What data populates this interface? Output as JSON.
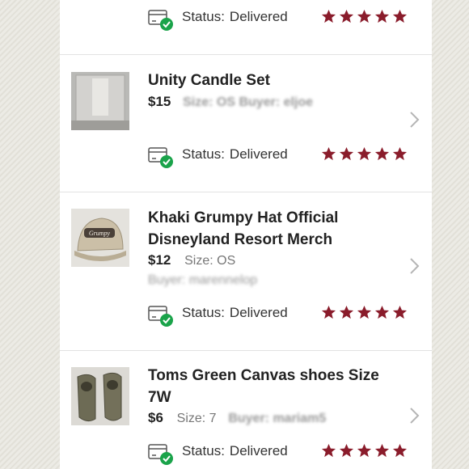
{
  "listings": [
    {
      "title_lines": [],
      "price": "",
      "status_label": "Status:",
      "status_value": "Delivered",
      "rating": 5
    },
    {
      "title_lines": [
        "Unity Candle Set"
      ],
      "price": "$15",
      "meta": "Size: OS  Buyer: eljoe",
      "status_label": "Status:",
      "status_value": "Delivered",
      "rating": 5
    },
    {
      "title_lines": [
        "Khaki Grumpy Hat Official",
        "Disneyland Resort Merch"
      ],
      "price": "$12",
      "size": "Size: OS",
      "buyer": "Buyer: marennelop",
      "status_label": "Status:",
      "status_value": "Delivered",
      "rating": 5
    },
    {
      "title_lines": [
        "Toms Green Canvas shoes Size",
        "7W"
      ],
      "price": "$6",
      "size": "Size: 7",
      "buyer": "Buyer: mariam5",
      "status_label": "Status:",
      "status_value": "Delivered",
      "rating": 5
    }
  ],
  "colors": {
    "star": "#8a1c2b",
    "check": "#1aa34a",
    "chevron": "#b5b5b5"
  }
}
